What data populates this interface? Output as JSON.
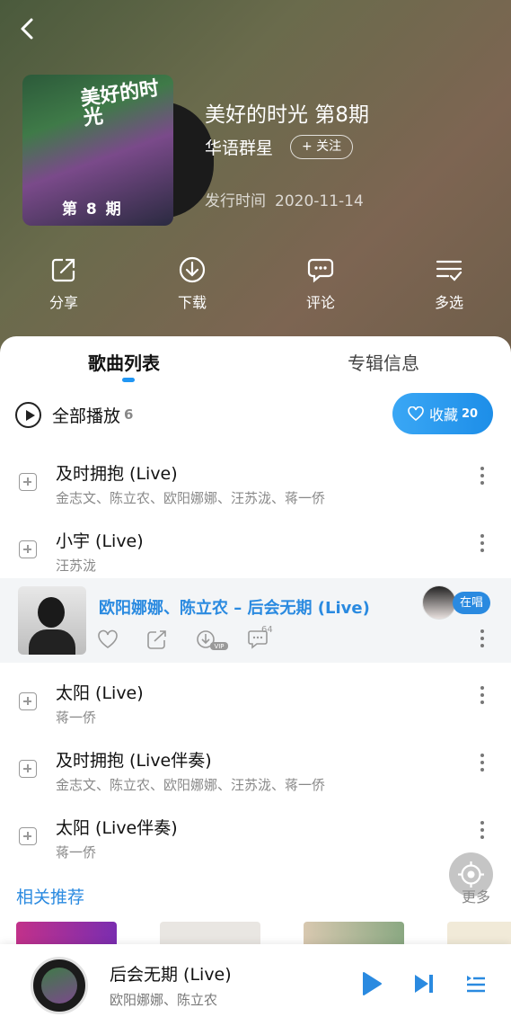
{
  "album": {
    "title": "美好的时光 第8期",
    "artist": "华语群星",
    "follow_label": "+ 关注",
    "release_label": "发行时间",
    "release_date": "2020-11-14",
    "cover_text": "第 8 期",
    "cover_logo": "美好的时光"
  },
  "actions": [
    {
      "label": "分享",
      "icon": "share-icon"
    },
    {
      "label": "下载",
      "icon": "download-icon"
    },
    {
      "label": "评论",
      "icon": "comment-icon"
    },
    {
      "label": "多选",
      "icon": "multiselect-icon"
    }
  ],
  "tabs": {
    "songs": "歌曲列表",
    "info": "专辑信息"
  },
  "play_all": {
    "label": "全部播放",
    "count": "6"
  },
  "collect": {
    "label": "收藏",
    "count": "20"
  },
  "songs": [
    {
      "name": "及时拥抱 (Live)",
      "artists": "金志文、陈立农、欧阳娜娜、汪苏泷、蒋一侨"
    },
    {
      "name": "小宇 (Live)",
      "artists": "汪苏泷"
    },
    {
      "name": "太阳 (Live)",
      "artists": "蒋一侨"
    },
    {
      "name": "及时拥抱 (Live伴奏)",
      "artists": "金志文、陈立农、欧阳娜娜、汪苏泷、蒋一侨"
    },
    {
      "name": "太阳 (Live伴奏)",
      "artists": "蒋一侨"
    }
  ],
  "current": {
    "title": "欧阳娜娜、陈立农 – 后会无期 (Live)",
    "comment_count": "64",
    "vip": "VIP",
    "live_badge": "在唱"
  },
  "related": {
    "title": "相关推荐",
    "more": "更多"
  },
  "player": {
    "title": "后会无期 (Live)",
    "artist": "欧阳娜娜、陈立农"
  },
  "colors": {
    "accent": "#2a8ae0",
    "collect": "#1d8ee8"
  }
}
